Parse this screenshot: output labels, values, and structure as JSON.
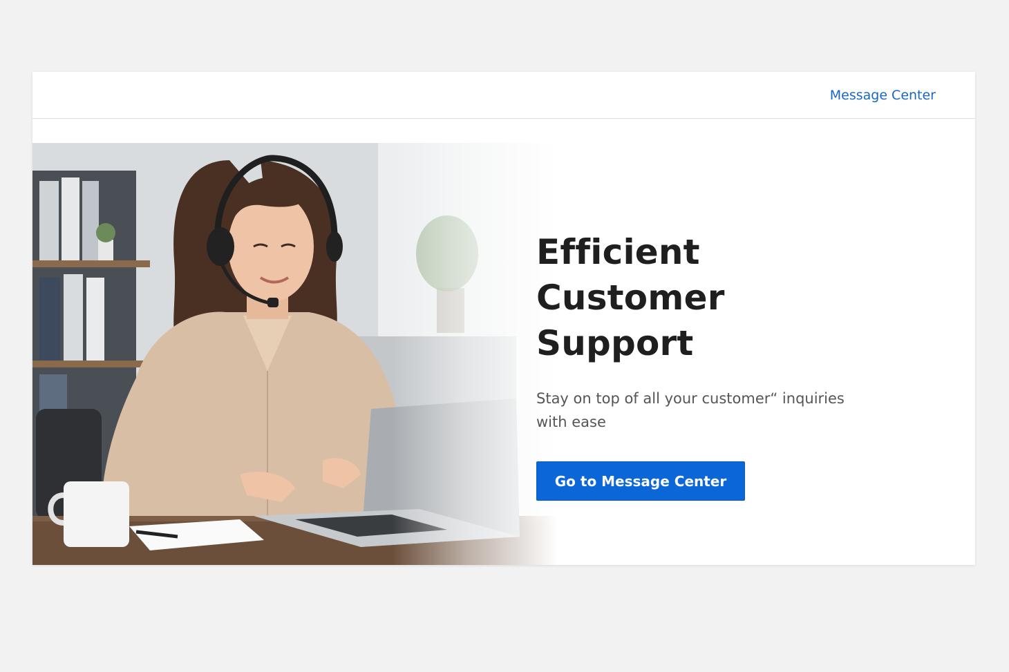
{
  "header": {
    "nav_link": "Message Center"
  },
  "hero": {
    "title": "Efficient Customer Support",
    "subtitle": "Stay on top of all your customer“ inquiries with ease",
    "cta_label": "Go to Message Center",
    "image_subject": "support-agent-with-headset-at-laptop"
  },
  "colors": {
    "page_background": "#f2f2f2",
    "card_background": "#ffffff",
    "link": "#1767c2",
    "primary_button": "#0b66d8",
    "heading_text": "#1f1f1f",
    "body_text": "#555555"
  }
}
